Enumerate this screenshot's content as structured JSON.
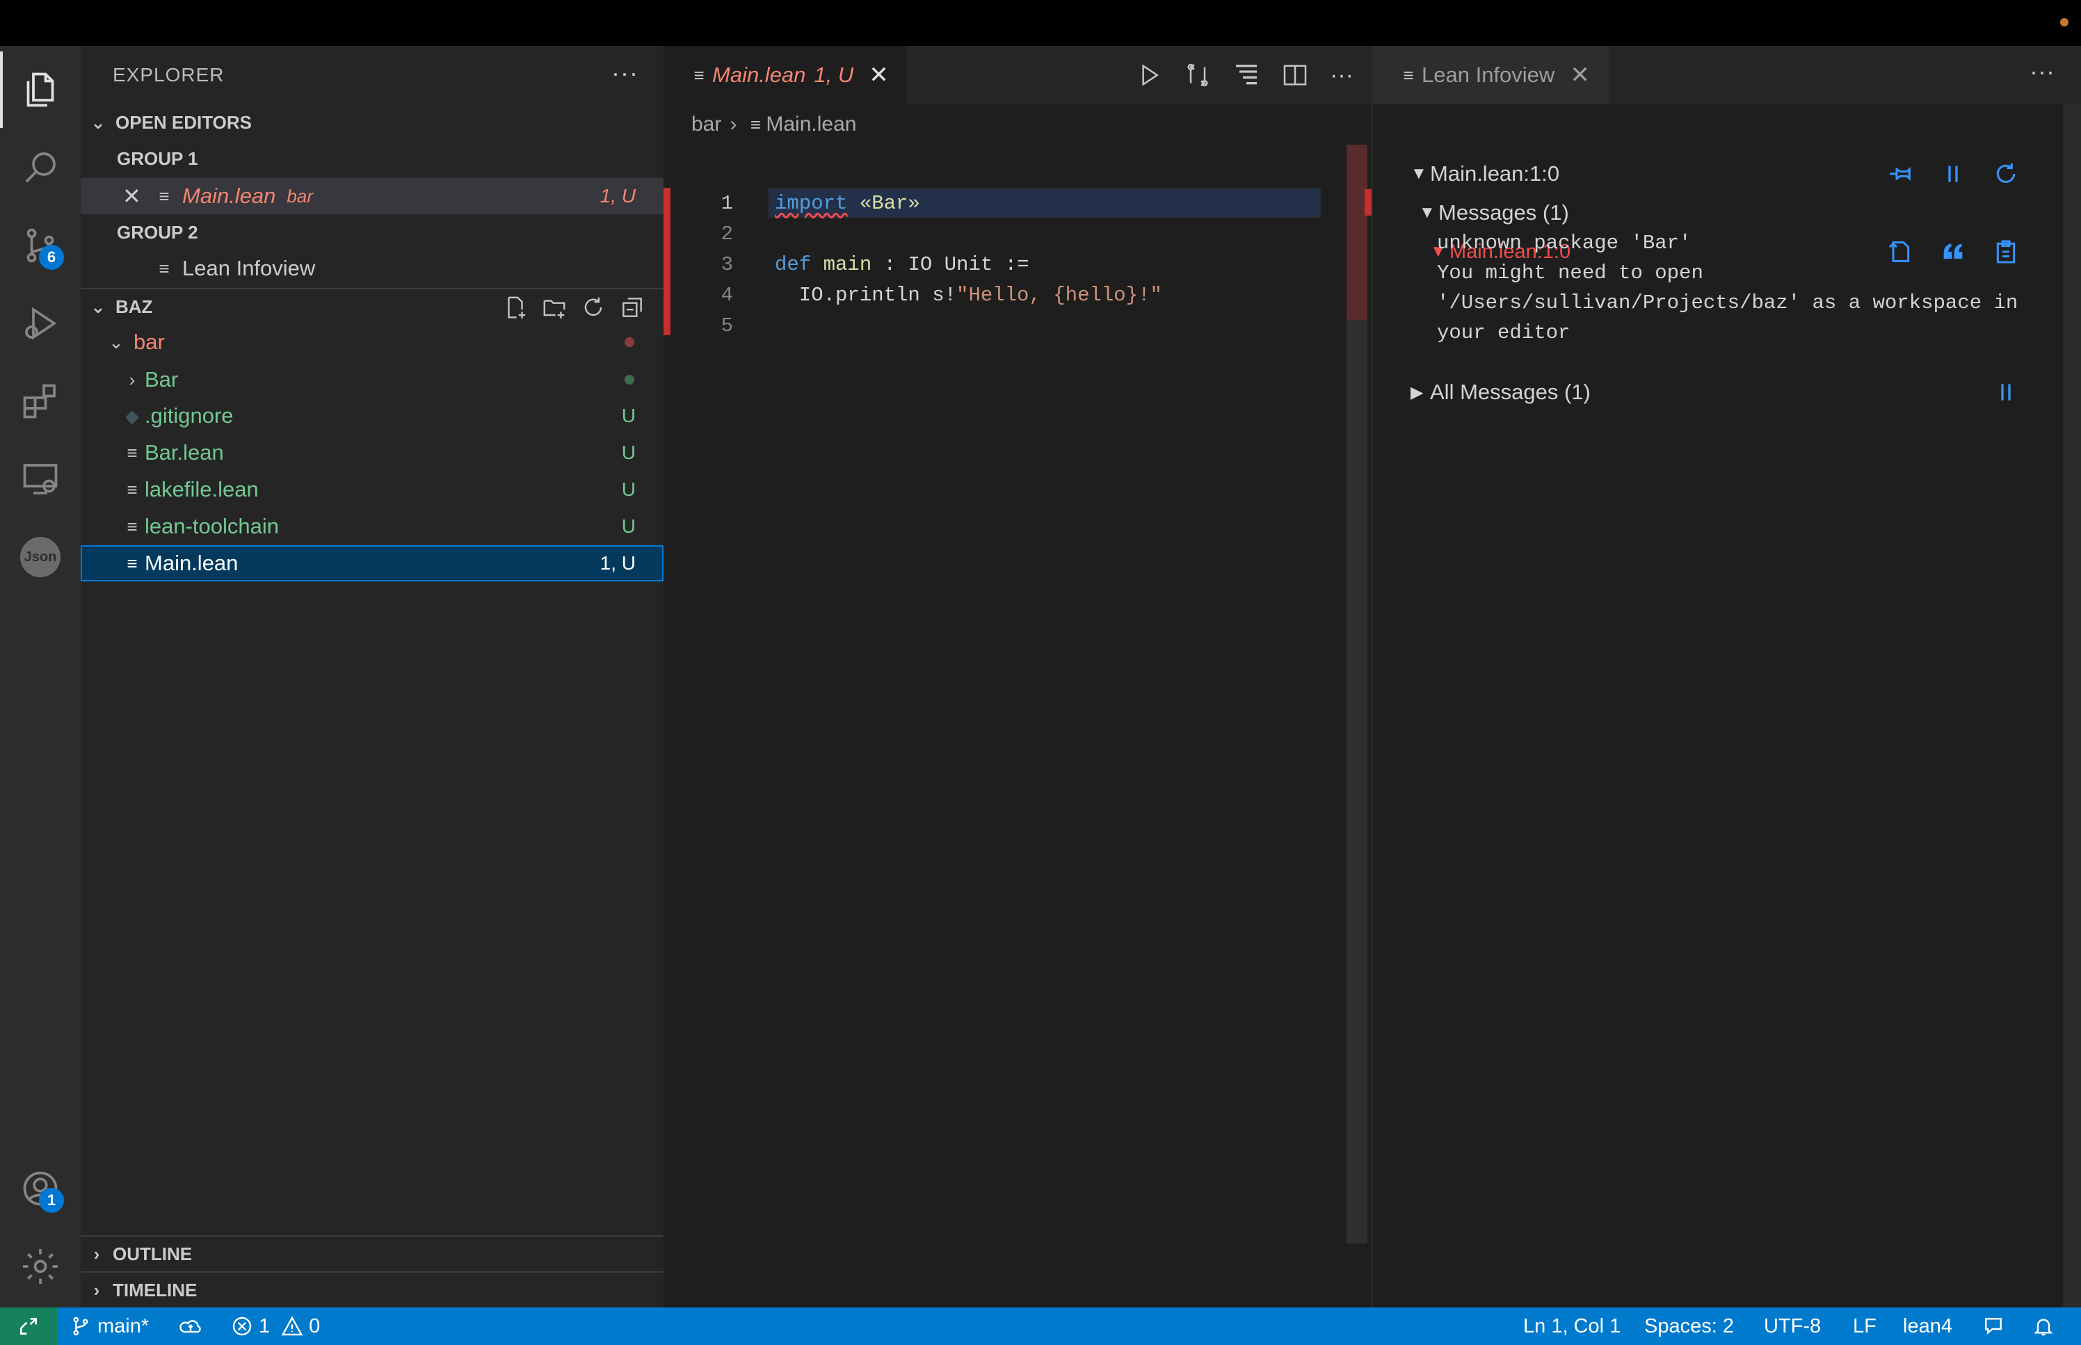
{
  "colors": {
    "accent": "#007acc",
    "error": "#f14c4c",
    "untracked": "#73c991",
    "badge": "#0078d4"
  },
  "activity_bar": {
    "items": [
      {
        "name": "explorer",
        "icon": "files-icon"
      },
      {
        "name": "search",
        "icon": "search-icon"
      },
      {
        "name": "source-control",
        "icon": "source-control-icon",
        "badge": "6"
      },
      {
        "name": "run-debug",
        "icon": "run-debug-icon"
      },
      {
        "name": "extensions",
        "icon": "extensions-icon"
      },
      {
        "name": "remote-explorer",
        "icon": "remote-explorer-icon"
      },
      {
        "name": "json",
        "icon": "json-icon",
        "label": "Json"
      }
    ],
    "accounts_badge": "1"
  },
  "sidebar": {
    "title": "EXPLORER",
    "more": "···",
    "open_editors": {
      "title": "OPEN EDITORS",
      "group1": "GROUP 1",
      "group1_file": "Main.lean",
      "group1_folder": "bar",
      "group1_status": "1, U",
      "group2": "GROUP 2",
      "group2_file": "Lean Infoview"
    },
    "workspace": {
      "title": "BAZ",
      "folder": "bar",
      "items": [
        {
          "label": "Bar",
          "status": ""
        },
        {
          "label": ".gitignore",
          "status": "U"
        },
        {
          "label": "Bar.lean",
          "status": "U"
        },
        {
          "label": "lakefile.lean",
          "status": "U"
        },
        {
          "label": "lean-toolchain",
          "status": "U"
        },
        {
          "label": "Main.lean",
          "status": "1, U"
        }
      ]
    },
    "outline": "OUTLINE",
    "timeline": "TIMELINE"
  },
  "editor": {
    "tab_label": "Main.lean",
    "tab_status": "1, U",
    "breadcrumb": [
      "bar",
      "Main.lean"
    ],
    "line_numbers": [
      "1",
      "2",
      "3",
      "4",
      "5"
    ],
    "code": {
      "l1_kw": "import",
      "l1_rest": " «Bar»",
      "l3_kw": "def",
      "l3_fn": " main",
      "l3_rest": " : IO Unit :=",
      "l4_plain": "  IO.println s!",
      "l4_str": "\"Hello, {hello}!\""
    }
  },
  "infoview": {
    "tab_label": "Lean Infoview",
    "position": "Main.lean:1:0",
    "messages_header": "Messages (1)",
    "message_loc": "Main.lean:1:0",
    "message_text": "unknown package 'Bar'\nYou might need to open\n'/Users/sullivan/Projects/baz' as a workspace in\nyour editor",
    "all_messages": "All Messages (1)"
  },
  "statusbar": {
    "branch": "main*",
    "errors": "1",
    "warnings": "0",
    "cursor": "Ln 1, Col 1",
    "spaces": "Spaces: 2",
    "encoding": "UTF-8",
    "eol": "LF",
    "language": "lean4"
  }
}
